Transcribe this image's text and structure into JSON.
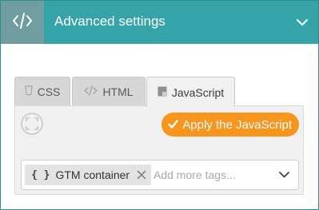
{
  "header": {
    "title": "Advanced settings",
    "code_icon": "code-icon",
    "collapse_icon": "chevron-down-icon",
    "color": "#35a3a8"
  },
  "tabs": [
    {
      "label": "CSS",
      "icon": "css-file-icon",
      "active": false
    },
    {
      "label": "HTML",
      "icon": "code-icon",
      "active": false
    },
    {
      "label": "JavaScript",
      "icon": "js-file-icon",
      "active": true
    }
  ],
  "toolbar": {
    "fullscreen_icon": "fullscreen-icon",
    "apply_label": "Apply the JavaScript",
    "apply_icon": "check-icon",
    "apply_color": "#f7951d"
  },
  "tags": {
    "items": [
      {
        "glyph": "{ }",
        "label": "GTM container",
        "remove_icon": "close-icon"
      }
    ],
    "placeholder": "Add more tags...",
    "dropdown_icon": "chevron-down-icon"
  }
}
